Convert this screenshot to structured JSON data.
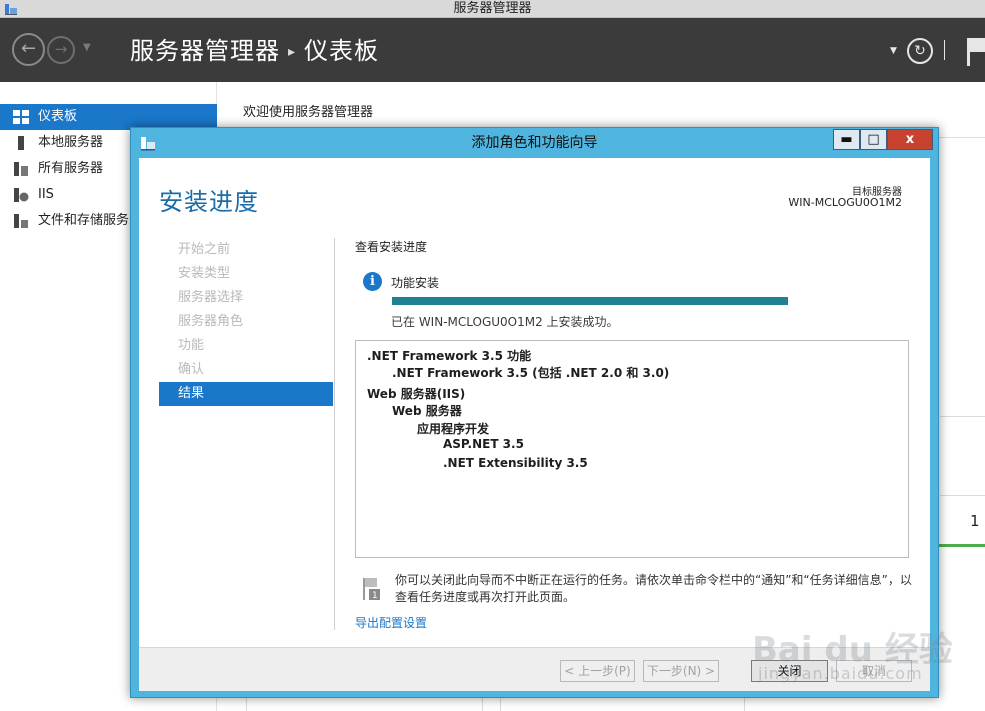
{
  "window": {
    "title": "服务器管理器"
  },
  "header": {
    "breadcrumb_root": "服务器管理器",
    "breadcrumb_separator": "▸",
    "breadcrumb_current": "仪表板"
  },
  "sidebar": {
    "items": [
      {
        "label": "仪表板",
        "icon": "dashboard-icon",
        "active": true
      },
      {
        "label": "本地服务器",
        "icon": "server-icon"
      },
      {
        "label": "所有服务器",
        "icon": "servers-icon"
      },
      {
        "label": "IIS",
        "icon": "iis-icon"
      },
      {
        "label": "文件和存储服务",
        "icon": "storage-icon"
      }
    ]
  },
  "main": {
    "welcome": "欢迎使用服务器管理器",
    "tile_count": "1"
  },
  "wizard": {
    "title": "添加角色和功能向导",
    "heading": "安装进度",
    "target_label": "目标服务器",
    "target_value": "WIN-MCLOGU0O1M2",
    "steps": [
      {
        "label": "开始之前"
      },
      {
        "label": "安装类型"
      },
      {
        "label": "服务器选择"
      },
      {
        "label": "服务器角色"
      },
      {
        "label": "功能"
      },
      {
        "label": "确认"
      },
      {
        "label": "结果",
        "active": true
      }
    ],
    "section_title": "查看安装进度",
    "feature_label": "功能安装",
    "progress_fraction": 1.0,
    "status_message": "已在 WIN-MCLOGU0O1M2 上安装成功。",
    "results": [
      ".NET Framework 3.5 功能",
      ".NET Framework 3.5 (包括 .NET 2.0 和 3.0)",
      "Web 服务器(IIS)",
      "Web 服务器",
      "应用程序开发",
      "ASP.NET 3.5",
      ".NET Extensibility 3.5"
    ],
    "note": "你可以关闭此向导而不中断正在运行的任务。请依次单击命令栏中的“通知”和“任务详细信息”，以查看任务进度或再次打开此页面。",
    "export_link": "导出配置设置",
    "buttons": {
      "prev": "< 上一步(P)",
      "next": "下一步(N) >",
      "close": "关闭",
      "cancel": "取消"
    }
  },
  "watermark": {
    "text": "Bai du 经验",
    "sub": "jingyan.baidu.com"
  }
}
